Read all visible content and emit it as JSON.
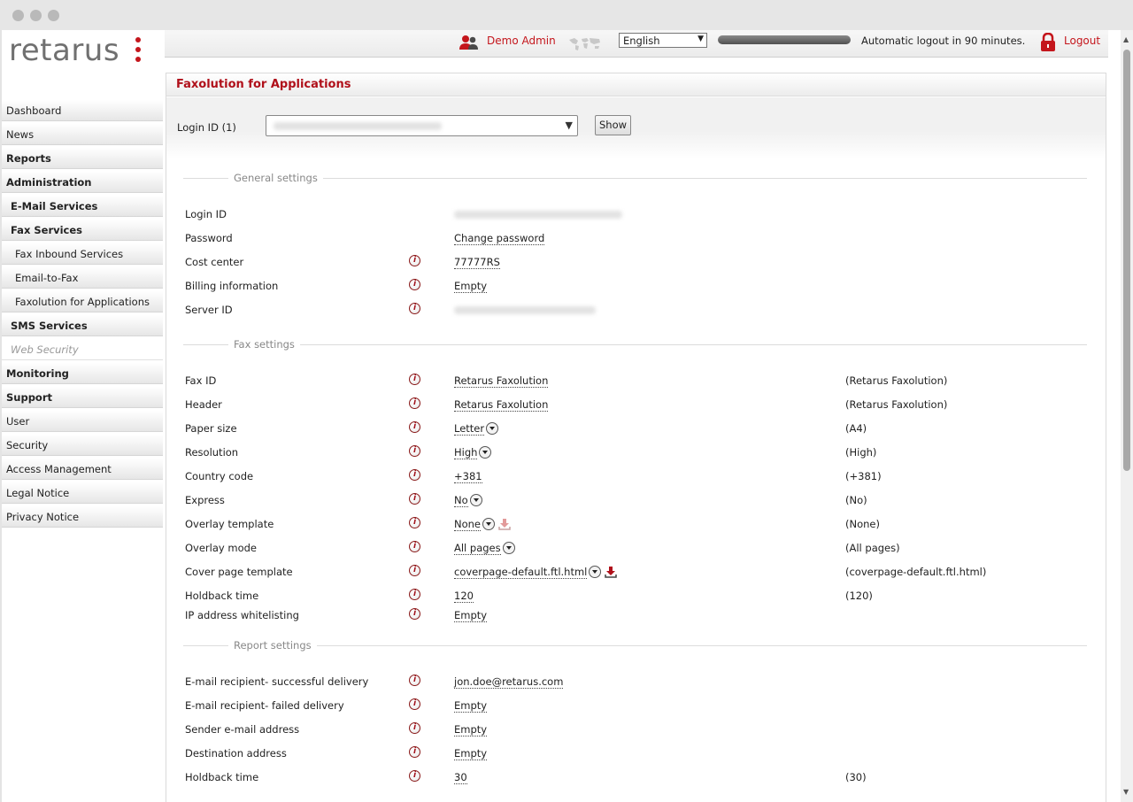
{
  "brand": {
    "name": "retarus"
  },
  "topbar": {
    "user": "Demo Admin",
    "language": "English",
    "session_remaining_fraction": 1.0,
    "auto_logout": "Automatic logout in 90 minutes.",
    "logout": "Logout"
  },
  "sidebar": {
    "items": [
      {
        "label": "Dashboard"
      },
      {
        "label": "News"
      },
      {
        "label": "Reports"
      },
      {
        "label": "Administration"
      },
      {
        "label": "E-Mail Services"
      },
      {
        "label": "Fax Services"
      },
      {
        "label": "Fax Inbound Services"
      },
      {
        "label": "Email-to-Fax"
      },
      {
        "label": "Faxolution for Applications"
      },
      {
        "label": "SMS Services"
      },
      {
        "label": "Web Security"
      },
      {
        "label": "Monitoring"
      },
      {
        "label": "Support"
      },
      {
        "label": "User"
      },
      {
        "label": "Security"
      },
      {
        "label": "Access Management"
      },
      {
        "label": "Legal Notice"
      },
      {
        "label": "Privacy Notice"
      }
    ]
  },
  "page": {
    "title": "Faxolution for Applications",
    "login_label": "Login ID (1)",
    "show_button": "Show"
  },
  "general": {
    "title": "General settings",
    "login_id": "Login ID",
    "password": "Password",
    "password_value": "Change password",
    "cost_center": "Cost center",
    "cost_center_value": "77777RS",
    "billing": "Billing information",
    "billing_value": "Empty",
    "server_id": "Server ID"
  },
  "fax": {
    "title": "Fax settings",
    "rows": [
      {
        "label": "Fax ID",
        "value": "Retarus Faxolution",
        "default": "(Retarus Faxolution)"
      },
      {
        "label": "Header",
        "value": "Retarus Faxolution",
        "default": "(Retarus Faxolution)"
      },
      {
        "label": "Paper size",
        "value": "Letter",
        "default": "(A4)"
      },
      {
        "label": "Resolution",
        "value": "High",
        "default": "(High)"
      },
      {
        "label": "Country code",
        "value": "+381",
        "default": "(+381)"
      },
      {
        "label": "Express",
        "value": "No",
        "default": "(No)"
      },
      {
        "label": "Overlay template",
        "value": "None",
        "default": "(None)"
      },
      {
        "label": "Overlay mode",
        "value": "All pages",
        "default": "(All pages)"
      },
      {
        "label": "Cover page template",
        "value": "coverpage-default.ftl.html",
        "default": "(coverpage-default.ftl.html)"
      },
      {
        "label": "Holdback time",
        "value": "120",
        "default": "(120)"
      },
      {
        "label": "IP address whitelisting",
        "value": "Empty",
        "default": ""
      }
    ]
  },
  "report": {
    "title": "Report settings",
    "rows": [
      {
        "label": "E-mail recipient- successful delivery",
        "value": "jon.doe@retarus.com",
        "default": ""
      },
      {
        "label": "E-mail recipient- failed delivery",
        "value": "Empty",
        "default": ""
      },
      {
        "label": "Sender e-mail address",
        "value": "Empty",
        "default": ""
      },
      {
        "label": "Destination address",
        "value": "Empty",
        "default": ""
      },
      {
        "label": "Holdback time",
        "value": "30",
        "default": "(30)"
      }
    ]
  },
  "icons": {
    "info": "info-icon",
    "dropdown": "dropdown-icon",
    "download": "download-icon",
    "lock": "lock-icon",
    "users": "users-icon",
    "world_map": "world-map-icon"
  },
  "colors": {
    "accent": "#c4161c"
  }
}
